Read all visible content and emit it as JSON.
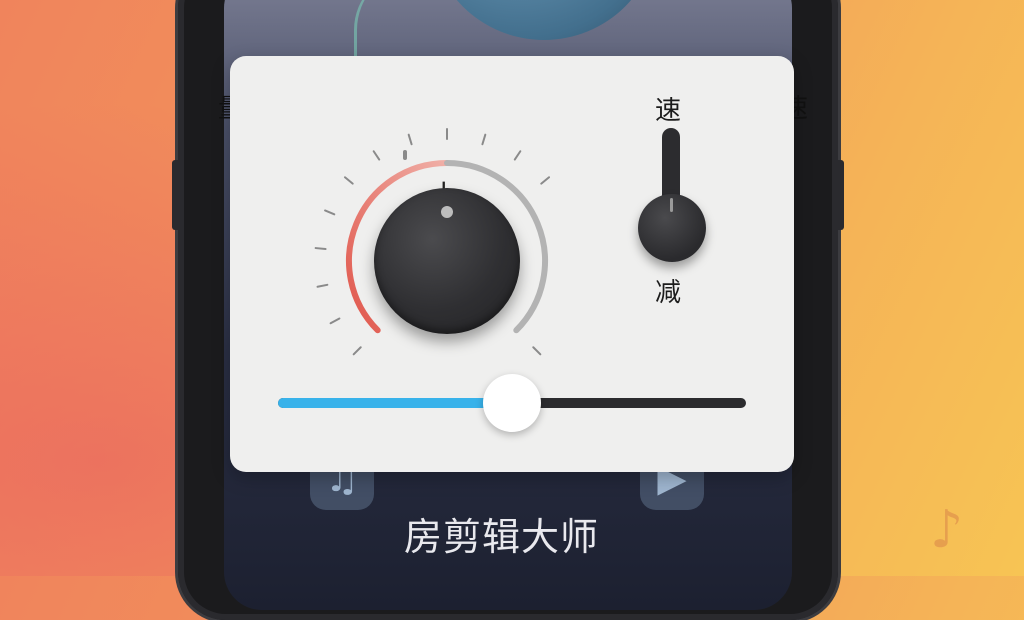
{
  "app": {
    "title": "房剪辑大师"
  },
  "knob": {
    "plus_label": "+",
    "value": 0.5
  },
  "speed": {
    "up_label": "速",
    "down_label": "减",
    "value": 0.25
  },
  "slider": {
    "value": 0.5
  },
  "edges": {
    "left_char": "量",
    "right_char": "速"
  },
  "icons": {
    "top_left": "music-note-icon",
    "top_right": "music-play-icon",
    "dock_left": "music-note-icon",
    "dock_right": "play-icon"
  },
  "colors": {
    "slider_fill": "#38b2ea",
    "arc_red": "#e0554a",
    "arc_gray": "#b3b3b3"
  }
}
